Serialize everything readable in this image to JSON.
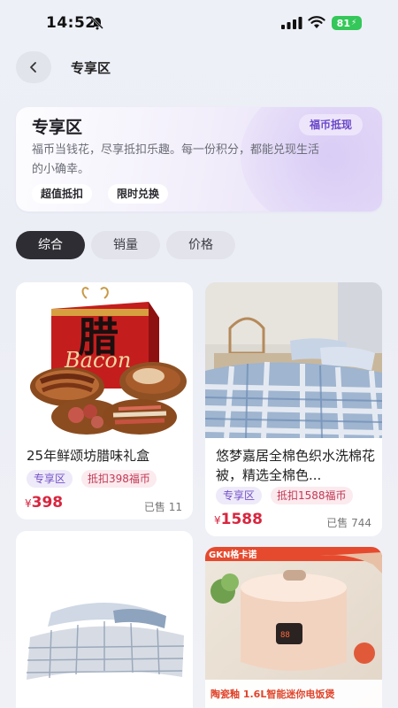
{
  "status_bar": {
    "time": "14:52",
    "battery": "81"
  },
  "header": {
    "title": "专享区"
  },
  "banner": {
    "title": "专享区",
    "tag": "福币抵现",
    "description": "福币当钱花，尽享抵扣乐趣。每一份积分，都能兑现生活的小确幸。",
    "chips": [
      "超值抵扣",
      "限时兑换"
    ]
  },
  "tabs": [
    "综合",
    "销量",
    "价格"
  ],
  "active_tab": "综合",
  "products": [
    {
      "title": "25年鲜颂坊腊味礼盒",
      "zone_badge": "专享区",
      "deduct_badge": "抵扣398福币",
      "currency": "¥",
      "price": "398",
      "sold": "已售 11",
      "image_text": "Bacon"
    },
    {
      "title": "悠梦嘉居全棉色织水洗棉花被，精选全棉色...",
      "zone_badge": "专享区",
      "deduct_badge": "抵扣1588福币",
      "currency": "¥",
      "price": "1588",
      "sold": "已售 744"
    },
    {
      "title": "",
      "image": "bedding-set"
    },
    {
      "image_brand": "GKN格卡诺",
      "image_caption": "陶瓷釉 1.6L智能迷你电饭煲"
    }
  ],
  "colors": {
    "accent": "#6b48c9",
    "price": "#d8263f",
    "tab_active": "#2d2d33"
  }
}
